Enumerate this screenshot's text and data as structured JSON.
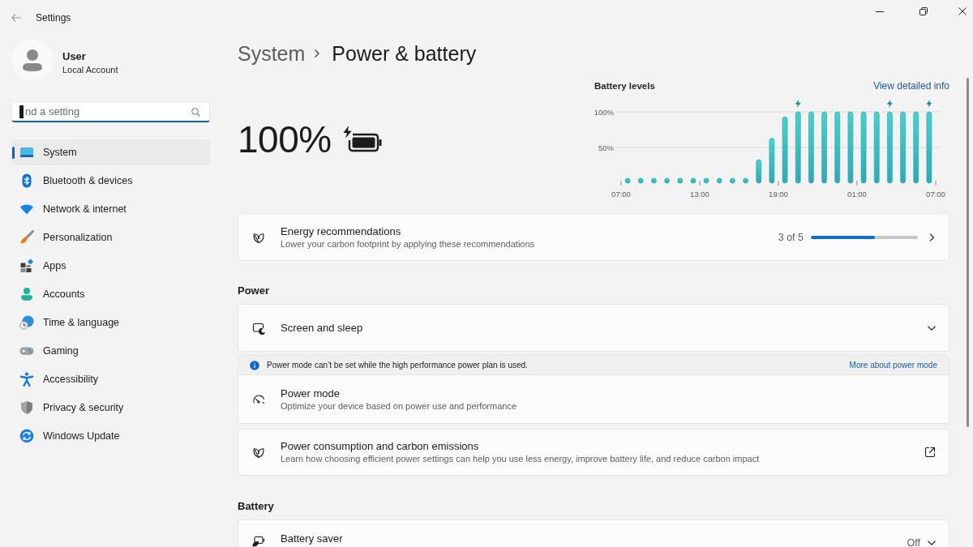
{
  "window": {
    "title": "Settings"
  },
  "user": {
    "name": "User",
    "account": "Local Account"
  },
  "search": {
    "placeholder": "nd a setting",
    "focused": true
  },
  "nav": [
    {
      "label": "System",
      "selected": true
    },
    {
      "label": "Bluetooth & devices",
      "selected": false
    },
    {
      "label": "Network & internet",
      "selected": false
    },
    {
      "label": "Personalization",
      "selected": false
    },
    {
      "label": "Apps",
      "selected": false
    },
    {
      "label": "Accounts",
      "selected": false
    },
    {
      "label": "Time & language",
      "selected": false
    },
    {
      "label": "Gaming",
      "selected": false
    },
    {
      "label": "Accessibility",
      "selected": false
    },
    {
      "label": "Privacy & security",
      "selected": false
    },
    {
      "label": "Windows Update",
      "selected": false
    }
  ],
  "breadcrumb": {
    "parent": "System",
    "current": "Power & battery"
  },
  "battery": {
    "percent": "100%",
    "charging": true
  },
  "battery_levels": {
    "link": "View detailed info",
    "charging_marks": [
      false,
      false,
      false,
      false,
      false,
      false,
      false,
      false,
      false,
      false,
      false,
      false,
      false,
      true,
      false,
      false,
      false,
      false,
      false,
      false,
      true,
      false,
      false,
      true
    ],
    "chart_data": {
      "type": "bar",
      "title": "Battery levels",
      "categories": [
        "07:00",
        null,
        null,
        null,
        null,
        null,
        "13:00",
        null,
        null,
        null,
        null,
        null,
        "19:00",
        null,
        null,
        null,
        null,
        null,
        "01:00",
        null,
        null,
        null,
        null,
        null,
        "07:00"
      ],
      "values": [
        7,
        7,
        7,
        7,
        7,
        7,
        7,
        7,
        7,
        7,
        33,
        63,
        93,
        100,
        100,
        100,
        100,
        100,
        100,
        100,
        100,
        100,
        100,
        100,
        null
      ],
      "ylim": [
        0,
        100
      ],
      "yticks": [
        {
          "value": 50,
          "label": "50%"
        },
        {
          "value": 100,
          "label": "100%"
        }
      ]
    }
  },
  "energy_recommendations": {
    "title": "Energy recommendations",
    "subtitle": "Lower your carbon footprint by applying these recommendations",
    "progress_text": "3 of 5",
    "level": 0.6
  },
  "power": {
    "heading": "Power",
    "items": [
      {
        "kind": "expander",
        "title": "Screen and sleep",
        "expanded": false
      },
      {
        "kind": "notice",
        "notice": "Power mode can’t be set while the high performance power plan is used.",
        "notice_link": "More about power mode",
        "title": "Power mode",
        "subtitle": "Optimize your device based on power use and performance"
      },
      {
        "kind": "external",
        "title": "Power consumption and carbon emissions",
        "subtitle": "Learn how choosing efficient power settings can help you use less energy, improve battery life, and reduce carbon impact"
      }
    ]
  },
  "battery_section": {
    "heading": "Battery",
    "items": [
      {
        "kind": "expander",
        "title": "Battery saver",
        "value": "Off",
        "expanded": false
      }
    ]
  }
}
